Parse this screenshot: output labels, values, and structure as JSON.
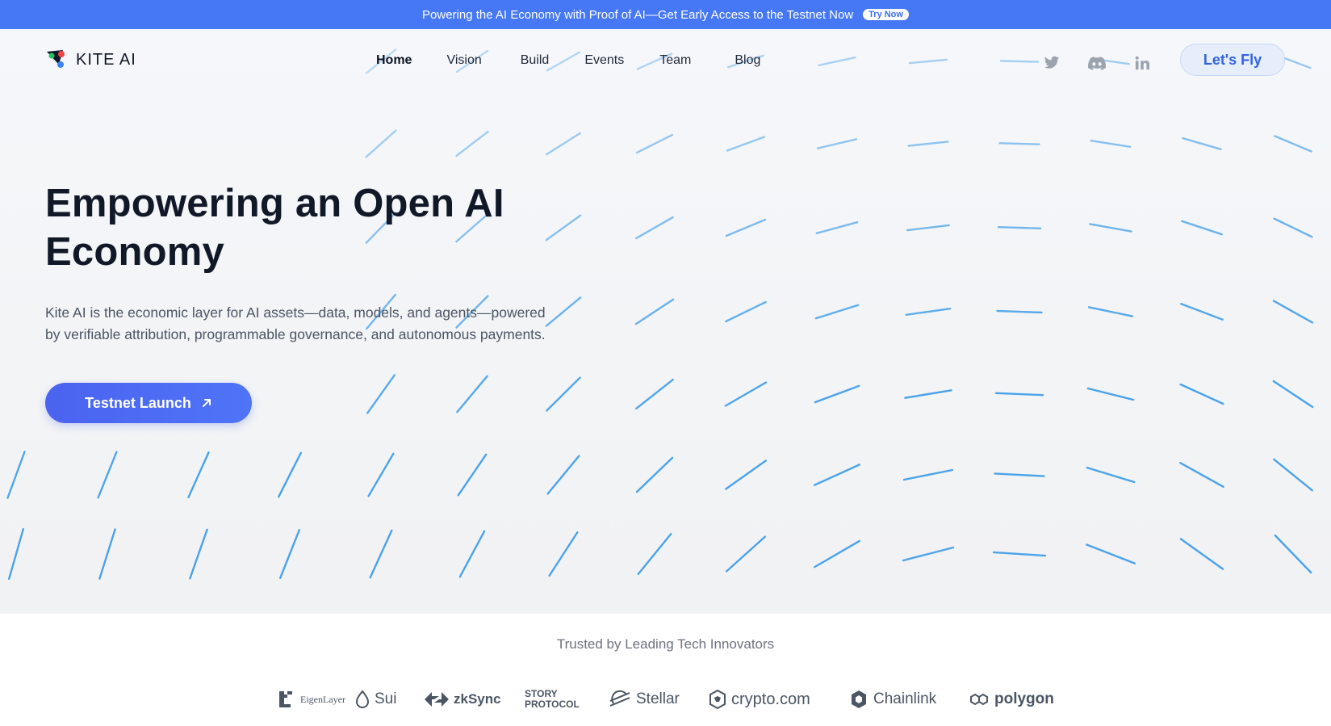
{
  "announcement": {
    "text": "Powering the AI Economy with Proof of AI—Get Early Access to the Testnet Now",
    "badge": "Try Now"
  },
  "header": {
    "logo_text": "KITE AI",
    "nav": [
      "Home",
      "Vision",
      "Build",
      "Events",
      "Team",
      "Blog"
    ],
    "active_nav": "Home",
    "socials": [
      "twitter-icon",
      "discord-icon",
      "linkedin-icon"
    ],
    "cta_label": "Let's Fly"
  },
  "hero": {
    "title_line1": "Empowering an Open AI",
    "title_line2": "Economy",
    "description_line1": "Kite AI is the economic layer for AI assets—data, models, and agents—powered",
    "description_line2": "by verifiable attribution, programmable governance, and autonomous payments.",
    "button_label": "Testnet Launch"
  },
  "trusted": {
    "heading": "Trusted by Leading Tech Innovators",
    "partners": [
      {
        "name": "EigenLayer",
        "icon": "eigenlayer-logo"
      },
      {
        "name": "Sui",
        "icon": "sui-logo"
      },
      {
        "name": "zkSync",
        "icon": "zksync-logo"
      },
      {
        "name": "STORY PROTOCOL",
        "icon": "story-protocol-logo"
      },
      {
        "name": "Stellar",
        "icon": "stellar-logo"
      },
      {
        "name": "crypto.com",
        "icon": "crypto-com-logo"
      },
      {
        "name": "Chainlink",
        "icon": "chainlink-logo"
      },
      {
        "name": "polygon",
        "icon": "polygon-logo"
      }
    ]
  },
  "colors": {
    "announcement_bg": "#4678f5",
    "accent": "#4f6ef5",
    "streak": "#4aa3ea"
  }
}
